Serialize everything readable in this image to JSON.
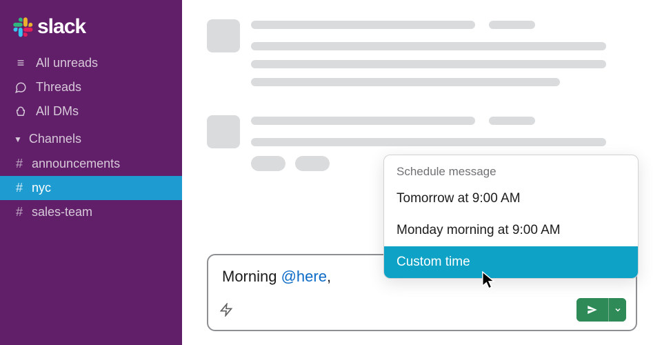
{
  "brand": {
    "name": "slack"
  },
  "sidebar": {
    "items": [
      {
        "label": "All unreads"
      },
      {
        "label": "Threads"
      },
      {
        "label": "All DMs"
      }
    ],
    "channels_header": "Channels",
    "channels": [
      {
        "label": "announcements"
      },
      {
        "label": "nyc"
      },
      {
        "label": "sales-team"
      }
    ]
  },
  "composer": {
    "prefix": "Morning ",
    "mention": "@here",
    "suffix": ", "
  },
  "schedule": {
    "title": "Schedule message",
    "options": [
      "Tomorrow at 9:00 AM",
      "Monday morning at 9:00 AM",
      "Custom time"
    ]
  }
}
